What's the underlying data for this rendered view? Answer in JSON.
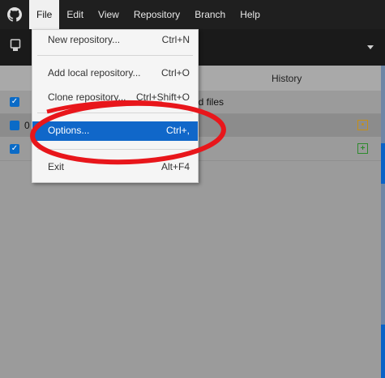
{
  "menubar": {
    "logo_icon": "github-octocat-icon",
    "items": [
      {
        "label": "File",
        "active": true
      },
      {
        "label": "Edit"
      },
      {
        "label": "View"
      },
      {
        "label": "Repository"
      },
      {
        "label": "Branch"
      },
      {
        "label": "Help"
      }
    ]
  },
  "toolbar": {
    "repo_icon": "repository-icon"
  },
  "tabs": {
    "history_label": "History"
  },
  "changes": {
    "rows": [
      {
        "text": "ed files",
        "checked": true
      },
      {
        "text": "0",
        "checked": true,
        "status_icon": "modified-icon",
        "status_glyph": "•"
      },
      {
        "text": "",
        "checked": true,
        "status_icon": "added-icon",
        "status_glyph": "+"
      }
    ]
  },
  "file_menu": {
    "items": [
      {
        "label": "New repository...",
        "shortcut": "Ctrl+N"
      },
      {
        "label": "Add local repository...",
        "shortcut": "Ctrl+O"
      },
      {
        "label": "Clone repository...",
        "shortcut": "Ctrl+Shift+O"
      },
      {
        "label": "Options...",
        "shortcut": "Ctrl+,",
        "highlighted": true
      },
      {
        "label": "Exit",
        "shortcut": "Alt+F4"
      }
    ]
  },
  "colors": {
    "highlight": "#1067c9",
    "annotation": "#e8161b",
    "checkbox": "#0b6bc7"
  }
}
